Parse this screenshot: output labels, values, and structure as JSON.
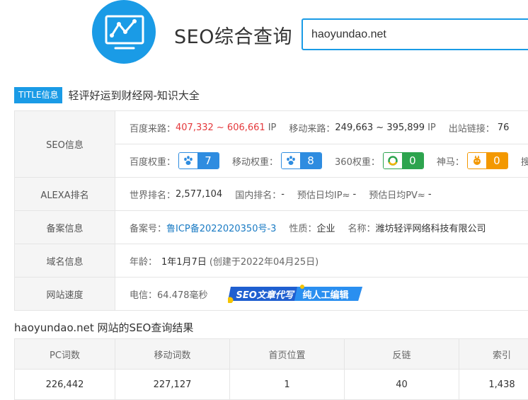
{
  "header": {
    "title": "SEO综合查询",
    "logo_icon": "chart-monitor-icon",
    "search_value": "haoyundao.net",
    "accent_color": "#1a9be6"
  },
  "title_info": {
    "badge": "TITLE信息",
    "text": "轻评好运到财经网-知识大全"
  },
  "seo_info": {
    "label": "SEO信息",
    "baidu_source_label": "百度来路：",
    "baidu_source_value": "407,332 ~ 606,661",
    "baidu_source_unit": "IP",
    "mobile_source_label": "移动来路：",
    "mobile_source_value": "249,663 ~ 395,899",
    "mobile_source_unit": "IP",
    "outbound_label": "出站链接：",
    "outbound_value": "76",
    "baidu_weight_label": "百度权重：",
    "baidu_weight_value": "7",
    "mobile_weight_label": "移动权重：",
    "mobile_weight_value": "8",
    "w360_label": "360权重：",
    "w360_value": "0",
    "shenma_label": "神马：",
    "shenma_value": "0",
    "sogou_label": "搜"
  },
  "alexa": {
    "label": "ALEXA排名",
    "world_label": "世界排名：",
    "world_value": "2,577,104",
    "domestic_label": "国内排名：",
    "domestic_value": "-",
    "ip_label": "预估日均IP≈",
    "ip_value": "-",
    "pv_label": "预估日均PV≈",
    "pv_value": "-"
  },
  "beian": {
    "label": "备案信息",
    "number_label": "备案号：",
    "number_value": "鲁ICP备2022020350号-3",
    "nature_label": "性质：",
    "nature_value": "企业",
    "name_label": "名称：",
    "name_value": "潍坊轻评网络科技有限公司"
  },
  "domain": {
    "label": "域名信息",
    "age_label": "年龄：",
    "age_value": "1年1月7日",
    "created": "(创建于2022年04月25日)"
  },
  "speed": {
    "label": "网站速度",
    "telecom_label": "电信：",
    "telecom_value": "64.478毫秒",
    "promo_text_1": "SEO文章代写",
    "promo_text_2": "纯人工编辑"
  },
  "results": {
    "title": "haoyundao.net 网站的SEO查询结果",
    "headers": [
      "PC词数",
      "移动词数",
      "首页位置",
      "反链",
      "索引"
    ],
    "row": [
      "226,442",
      "227,127",
      "1",
      "40",
      "1,438"
    ]
  }
}
